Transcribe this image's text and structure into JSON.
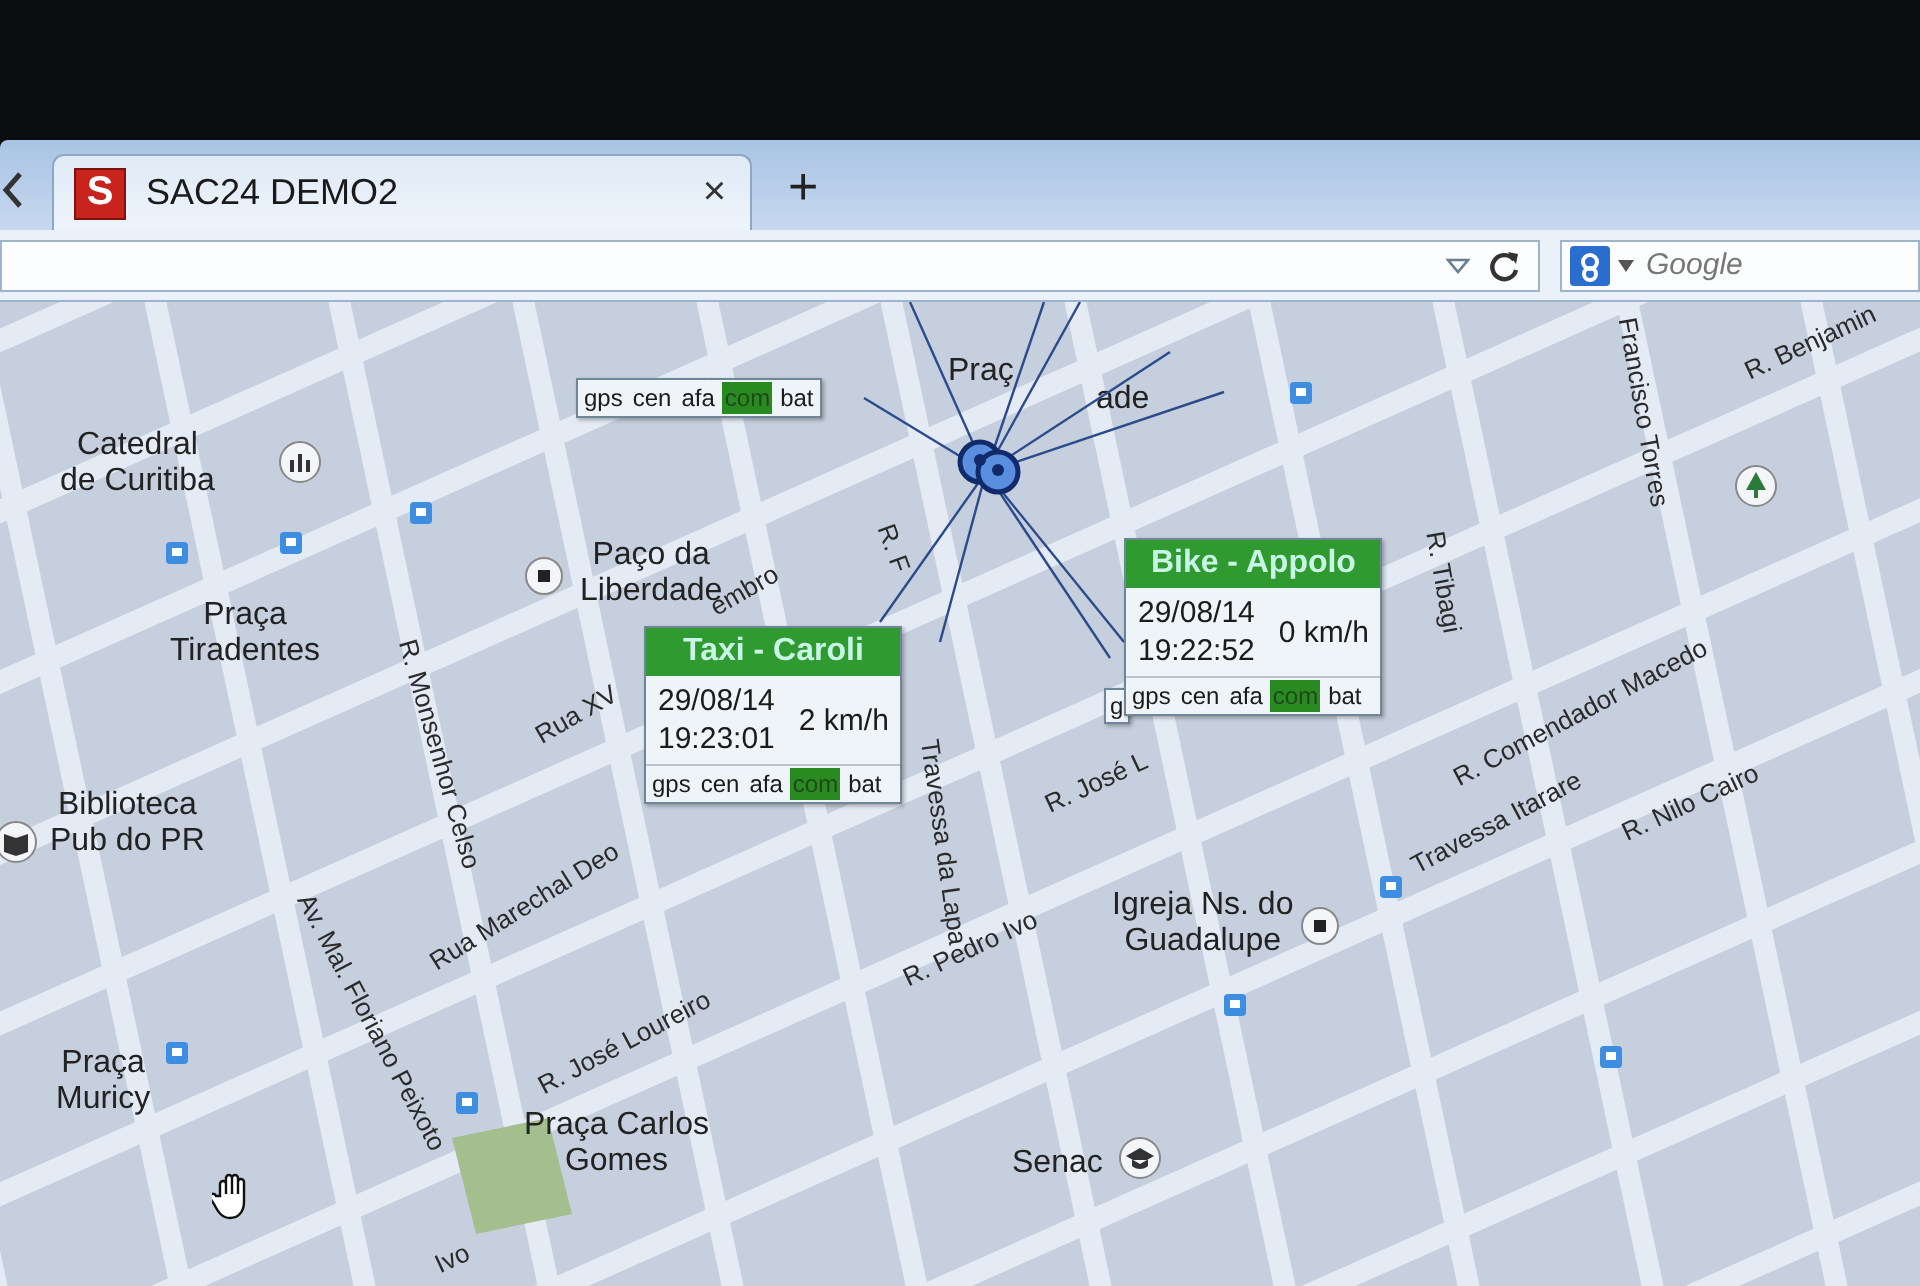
{
  "browser": {
    "tab": {
      "favicon_letter": "S",
      "title": "SAC24 DEMO2",
      "close": "×",
      "selected": true
    },
    "new_tab": "+",
    "search": {
      "placeholder": "Google"
    }
  },
  "map": {
    "places": [
      {
        "lines": [
          "Catedral",
          "de Curitiba"
        ]
      },
      {
        "lines": [
          "Praça",
          "Tiradentes"
        ]
      },
      {
        "lines": [
          "Paço da",
          "Liberdade"
        ]
      },
      {
        "lines": [
          "Biblioteca",
          "Pub do PR"
        ]
      },
      {
        "lines": [
          "Praça",
          "Muricy"
        ]
      },
      {
        "lines": [
          "Praça Carlos",
          "Gomes"
        ]
      },
      {
        "lines": [
          "Igreja Ns. do",
          "Guadalupe"
        ]
      },
      {
        "lines": [
          "Senac"
        ]
      },
      {
        "lines": [
          "Praç"
        ]
      },
      {
        "lines": [
          "ade"
        ]
      }
    ],
    "streets": [
      "R. Monsenhor Celso",
      "Rua XV",
      "embro",
      "Rua Marechal Deo",
      "Av. Mal. Floriano Peixoto",
      "R. José Loureiro",
      "Ivo",
      "R. Pedro Ivo",
      "R. José L",
      "Travessa da Lapa",
      "R. F",
      "R. Tibagi",
      "R. Comendador Macedo",
      "Travessa Itarare",
      "R. Nilo Cairo",
      "Francisco Torres",
      "R. Benjamin"
    ],
    "popups": [
      {
        "kind": "status_only",
        "status": [
          {
            "label": "gps",
            "on": false
          },
          {
            "label": "cen",
            "on": false
          },
          {
            "label": "afa",
            "on": false
          },
          {
            "label": "com",
            "on": true
          },
          {
            "label": "bat",
            "on": false
          }
        ]
      },
      {
        "kind": "full",
        "title": "Taxi - Caroli",
        "date": "29/08/14",
        "time": "19:23:01",
        "speed": "2 km/h",
        "status": [
          {
            "label": "gps",
            "on": false
          },
          {
            "label": "cen",
            "on": false
          },
          {
            "label": "afa",
            "on": false
          },
          {
            "label": "com",
            "on": true
          },
          {
            "label": "bat",
            "on": false
          }
        ]
      },
      {
        "kind": "fragment",
        "text": "g"
      },
      {
        "kind": "full",
        "title": "Bike - Appolo",
        "date": "29/08/14",
        "time": "19:22:52",
        "speed": "0 km/h",
        "status": [
          {
            "label": "gps",
            "on": false
          },
          {
            "label": "cen",
            "on": false
          },
          {
            "label": "afa",
            "on": false
          },
          {
            "label": "com",
            "on": true
          },
          {
            "label": "bat",
            "on": false
          }
        ]
      }
    ]
  }
}
